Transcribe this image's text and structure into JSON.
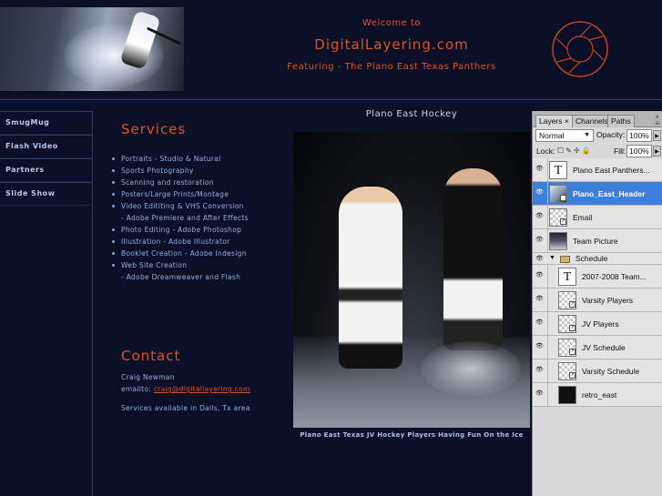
{
  "header": {
    "welcome": "Welcome to",
    "site_name": "DigitalLayering.com",
    "featuring": "Featuring - The Plano East Texas Panthers",
    "accent_color": "#e0531f"
  },
  "sidebar": {
    "items": [
      {
        "label": "SmugMug"
      },
      {
        "label": "Flash Video"
      },
      {
        "label": "Partners"
      },
      {
        "label": "Slide Show"
      }
    ]
  },
  "services": {
    "title": "Services",
    "items": [
      {
        "text": "Portraits - Studio & Natural",
        "bullet": true
      },
      {
        "text": "Sports Photography",
        "bullet": true
      },
      {
        "text": "Scanning and restoration",
        "bullet": true
      },
      {
        "text": "Posters/Large Prints/Montage",
        "bullet": true
      },
      {
        "text": "Video Edititing & VHS Conversion",
        "bullet": true
      },
      {
        "text": "- Adobe Premiere and After Effects",
        "bullet": false
      },
      {
        "text": "Photo Editing - Adobe Photoshop",
        "bullet": true
      },
      {
        "text": "Illustration - Adobe Illustrator",
        "bullet": true
      },
      {
        "text": "Booklet Creation - Adobe Indesign",
        "bullet": true
      },
      {
        "text": "Web Site Creation",
        "bullet": true
      },
      {
        "text": "- Adobe Dreamweaver and Flash",
        "bullet": false
      }
    ]
  },
  "contact": {
    "title": "Contact",
    "name": "Craig Newman",
    "email_prefix": "emailto:",
    "email": "craig@digitallayering.com",
    "area": "Services available in Dalls, Tx area"
  },
  "photo": {
    "title": "Plano East Hockey",
    "caption": "Plano East Texas JV Hockey Players Having Fun On the Ice"
  },
  "layers_panel": {
    "tabs": [
      "Layers",
      "Channels",
      "Paths"
    ],
    "blend_mode": "Normal",
    "opacity_label": "Opacity:",
    "opacity_value": "100%",
    "lock_label": "Lock:",
    "fill_label": "Fill:",
    "fill_value": "100%",
    "layers": [
      {
        "name": "Plano East Panthers...",
        "thumb": "type",
        "selected": false
      },
      {
        "name": "Plano_East_Header",
        "thumb": "header",
        "selected": true
      },
      {
        "name": "Email",
        "thumb": "checker",
        "selected": false
      },
      {
        "name": "Team Picture",
        "thumb": "photo",
        "selected": false
      }
    ],
    "group": {
      "name": "Schedule"
    },
    "group_layers": [
      {
        "name": "2007-2008 Team...",
        "thumb": "type"
      },
      {
        "name": "Varsity Players",
        "thumb": "checker"
      },
      {
        "name": "JV Players",
        "thumb": "checker"
      },
      {
        "name": "JV Schedule",
        "thumb": "checker"
      },
      {
        "name": "Varsity Schedule",
        "thumb": "checker"
      }
    ],
    "bottom_layer": {
      "name": "retro_east",
      "thumb": "dark"
    }
  }
}
